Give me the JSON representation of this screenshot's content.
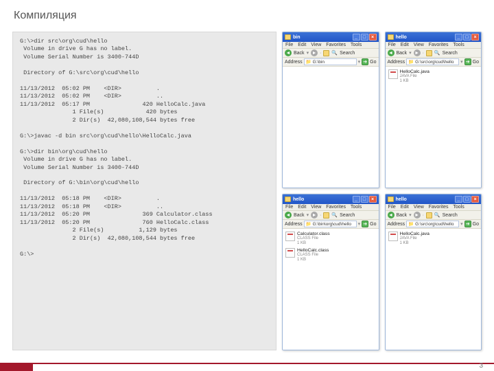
{
  "title": "Компиляция",
  "page_number": "3",
  "terminal_text": "G:\\>dir src\\org\\cud\\hello\n Volume in drive G has no label.\n Volume Serial Number is 3400-744D\n\n Directory of G:\\src\\org\\cud\\hello\n\n11/13/2012  05:02 PM    <DIR>          .\n11/13/2012  05:02 PM    <DIR>          ..\n11/13/2012  05:17 PM               420 HelloCalc.java\n               1 File(s)            420 bytes\n               2 Dir(s)  42,080,108,544 bytes free\n\nG:\\>javac -d bin src\\org\\cud\\hello\\HelloCalc.java\n\nG:\\>dir bin\\org\\cud\\hello\n Volume in drive G has no label.\n Volume Serial Number is 3400-744D\n\n Directory of G:\\bin\\org\\cud\\hello\n\n11/13/2012  05:18 PM    <DIR>          .\n11/13/2012  05:18 PM    <DIR>          ..\n11/13/2012  05:20 PM               369 Calculator.class\n11/13/2012  05:20 PM               760 HelloCalc.class\n               2 File(s)          1,129 bytes\n               2 Dir(s)  42,080,108,544 bytes free\n\nG:\\>",
  "menus": {
    "file": "File",
    "edit": "Edit",
    "view": "View",
    "favorites": "Favorites",
    "tools": "Tools"
  },
  "toolbar": {
    "back": "Back",
    "search": "Search"
  },
  "address_label": "Address",
  "go_label": "Go",
  "windows": [
    {
      "title": "bin",
      "path": "G:\\bin",
      "files": []
    },
    {
      "title": "hello",
      "path": "G:\\src\\org\\cud\\hello",
      "files": [
        {
          "name": "HelloCalc.java",
          "type": "JAVA File",
          "size": "1 KB"
        }
      ]
    },
    {
      "title": "hello",
      "path": "G:\\bin\\org\\cud\\hello",
      "files": [
        {
          "name": "Calculator.class",
          "type": "CLASS File",
          "size": "1 KB"
        },
        {
          "name": "HelloCalc.class",
          "type": "CLASS File",
          "size": "1 KB"
        }
      ]
    },
    {
      "title": "hello",
      "path": "G:\\src\\org\\cud\\hello",
      "files": [
        {
          "name": "HelloCalc.java",
          "type": "JAVA File",
          "size": "1 KB"
        }
      ]
    }
  ]
}
